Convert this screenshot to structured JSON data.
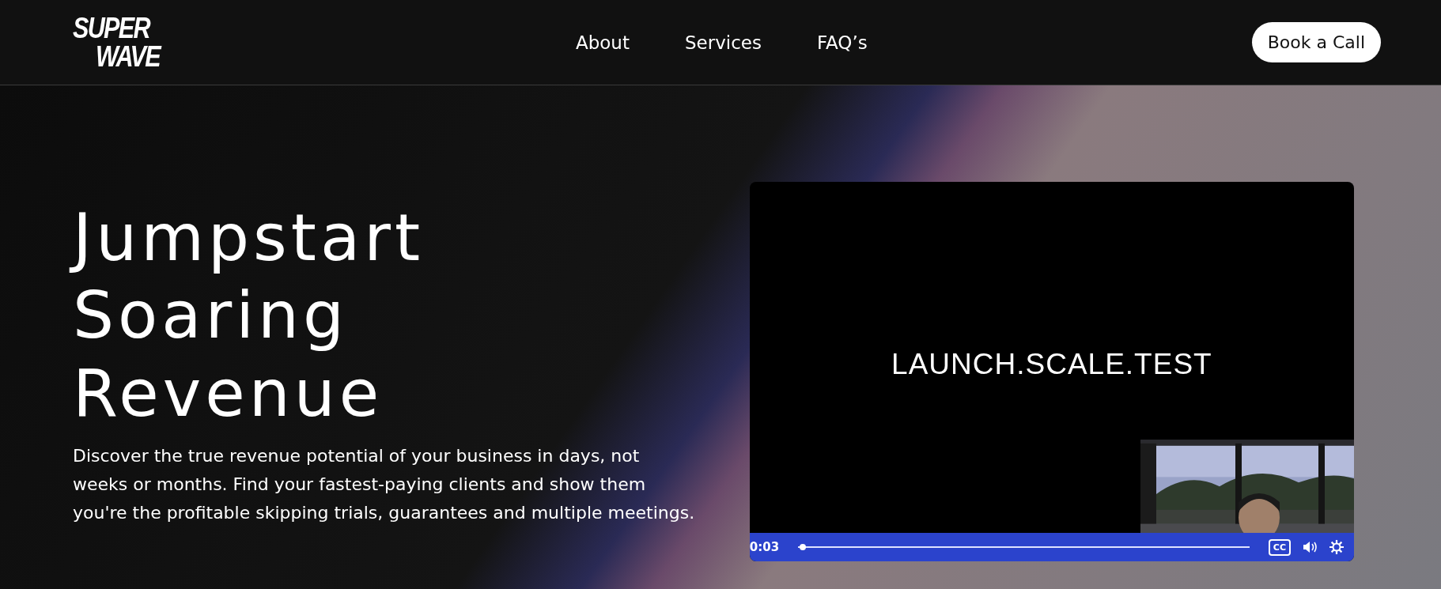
{
  "header": {
    "logo": [
      "SUPER",
      "WAVE"
    ],
    "nav": [
      {
        "label": "About"
      },
      {
        "label": "Services"
      },
      {
        "label": "FAQ’s"
      }
    ],
    "cta": "Book a Call"
  },
  "hero": {
    "title": [
      "Jumpstart",
      "Soaring",
      "Revenue"
    ],
    "description": "Discover the true revenue potential of your business in days, not weeks or months. Find your fastest-paying clients and show them you're the profitable skipping trials, guarantees and multiple meetings."
  },
  "video": {
    "slide_text": "LAUNCH.SCALE.TEST",
    "controls": {
      "time": "0:03",
      "level": 0.01,
      "captions_label": "CC"
    }
  }
}
